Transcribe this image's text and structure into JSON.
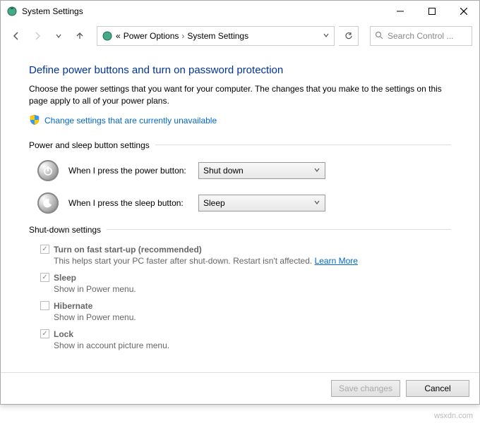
{
  "titlebar": {
    "title": "System Settings"
  },
  "breadcrumb": {
    "sep1": "«",
    "item1": "Power Options",
    "sep2": "›",
    "item2": "System Settings"
  },
  "search": {
    "placeholder": "Search Control ..."
  },
  "main": {
    "heading": "Define power buttons and turn on password protection",
    "intro": "Choose the power settings that you want for your computer. The changes that you make to the settings on this page apply to all of your power plans.",
    "change_link": "Change settings that are currently unavailable"
  },
  "power_section": {
    "title": "Power and sleep button settings",
    "power_label": "When I press the power button:",
    "power_value": "Shut down",
    "sleep_label": "When I press the sleep button:",
    "sleep_value": "Sleep"
  },
  "shutdown_section": {
    "title": "Shut-down settings",
    "fast": {
      "label": "Turn on fast start-up (recommended)",
      "desc": "This helps start your PC faster after shut-down. Restart isn't affected. ",
      "learn": "Learn More"
    },
    "sleep": {
      "label": "Sleep",
      "desc": "Show in Power menu."
    },
    "hibernate": {
      "label": "Hibernate",
      "desc": "Show in Power menu."
    },
    "lock": {
      "label": "Lock",
      "desc": "Show in account picture menu."
    }
  },
  "footer": {
    "save": "Save changes",
    "cancel": "Cancel"
  },
  "watermark": "wsxdn.com"
}
